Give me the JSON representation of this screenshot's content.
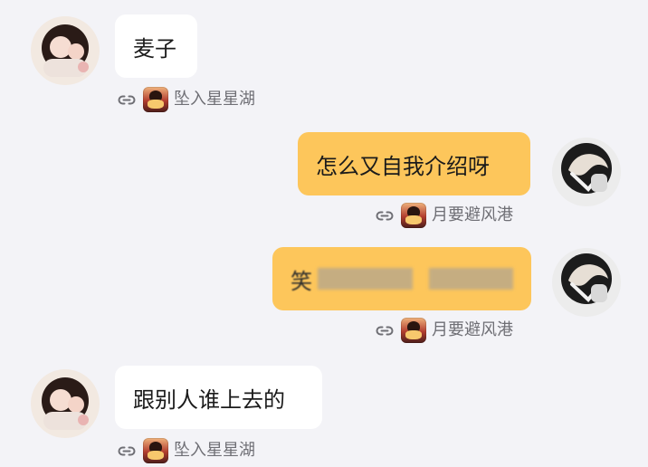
{
  "messages": [
    {
      "side": "left",
      "text": "麦子",
      "tag": "坠入星星湖"
    },
    {
      "side": "right",
      "text": "怎么又自我介绍呀",
      "tag": "月要避风港"
    },
    {
      "side": "right",
      "text": "笑",
      "tag": "月要避风港",
      "censored": true
    },
    {
      "side": "left",
      "text": "跟别人谁上去的",
      "tag": "坠入星星湖"
    }
  ],
  "colors": {
    "background": "#f3f3f7",
    "left_bubble": "#ffffff",
    "right_bubble": "#fdc65b",
    "tag_text": "#6f6f75"
  },
  "icons": {
    "link": "link-icon",
    "game": "game-icon"
  }
}
